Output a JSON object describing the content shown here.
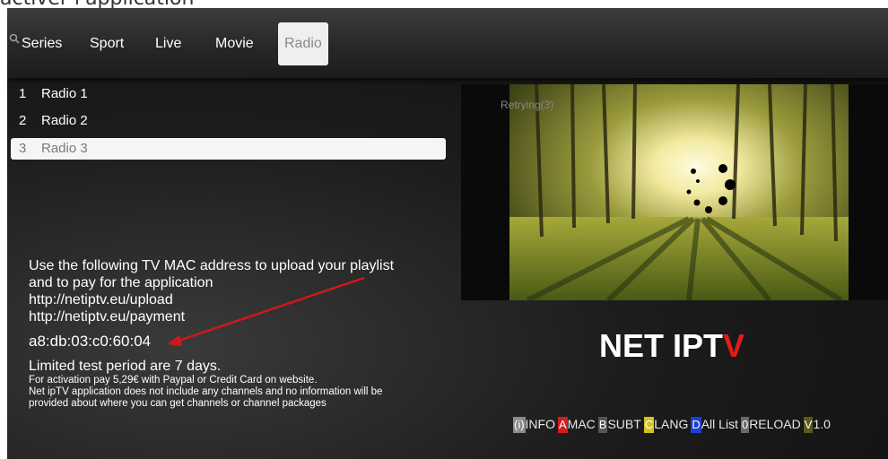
{
  "page_caption": "activer l'application",
  "tabs": [
    {
      "label": "Series",
      "active": false
    },
    {
      "label": "Sport",
      "active": false
    },
    {
      "label": "Live",
      "active": false
    },
    {
      "label": "Movie",
      "active": false
    },
    {
      "label": "Radio",
      "active": true
    }
  ],
  "channels": [
    {
      "num": "1",
      "name": "Radio 1",
      "selected": false
    },
    {
      "num": "2",
      "name": "Radio 2",
      "selected": false
    },
    {
      "num": "3",
      "name": "Radio 3",
      "selected": true
    }
  ],
  "info": {
    "line1": "Use the following TV MAC address to upload your playlist",
    "line2": "and to pay for the application",
    "url_upload": "http://netiptv.eu/upload",
    "url_payment": "http://netiptv.eu/payment",
    "mac_address": "a8:db:03:c0:60:04",
    "test_period": "Limited test period are 7 days.",
    "activation_note": "For activation pay 5,29€ with Paypal or Credit Card on website.",
    "disclaimer_1": "Net ipTV application does not include any channels and no information will be",
    "disclaimer_2": "provided about where you can get channels or channel packages"
  },
  "player": {
    "status": "Retrying(3)"
  },
  "logo": {
    "text_main": "NET IPT",
    "text_accent": "V",
    "accent_color": "#e31b1b"
  },
  "keys": [
    {
      "key": "(i)",
      "label": "INFO",
      "color": "#8a8a8a",
      "text_color": "#ffffff"
    },
    {
      "key": "A",
      "label": "MAC",
      "color": "#d41c1c",
      "text_color": "#ffffff"
    },
    {
      "key": "B",
      "label": "SUBT",
      "color": "#555555",
      "text_color": "#ffffff"
    },
    {
      "key": "C",
      "label": "LANG",
      "color": "#d4c21a",
      "text_color": "#ffffff"
    },
    {
      "key": "D",
      "label": "All List",
      "color": "#1c3fd4",
      "text_color": "#ffffff"
    },
    {
      "key": "0",
      "label": "RELOAD",
      "color": "#6a6a6a",
      "text_color": "#ffffff"
    },
    {
      "key": "V",
      "label": "1.0",
      "color": "#5a5a1a",
      "text_color": "#ffffff"
    }
  ]
}
